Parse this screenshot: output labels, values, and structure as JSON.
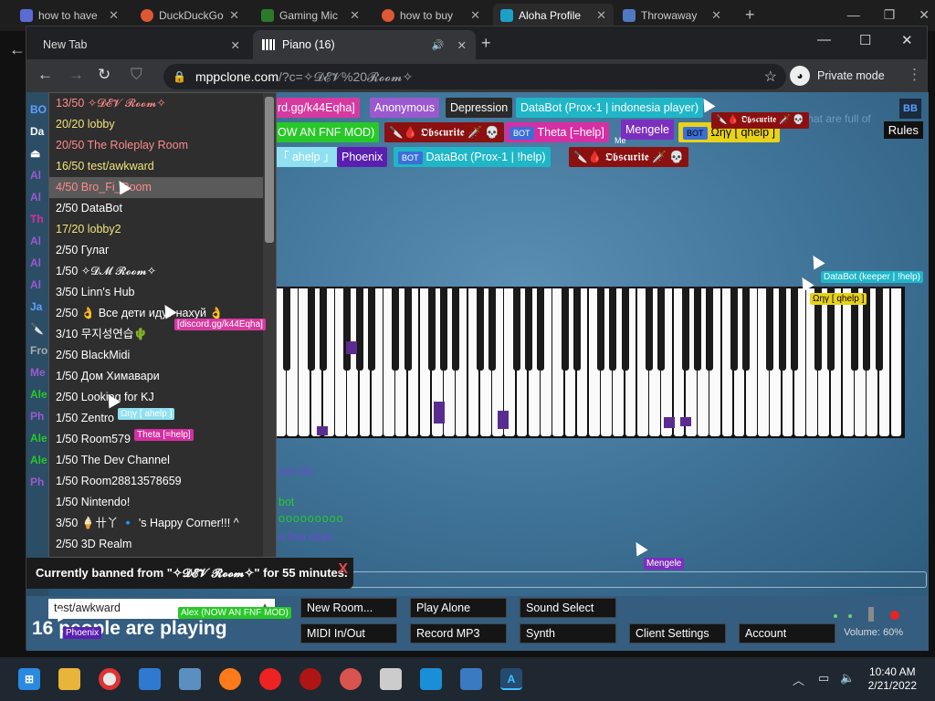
{
  "background_tabs": [
    {
      "title": "how to have",
      "color": "#5b6bd6"
    },
    {
      "title": "DuckDuckGo",
      "color": "#de5833"
    },
    {
      "title": "Gaming Mic",
      "color": "#2a7a2a"
    },
    {
      "title": "how to buy",
      "color": "#de5833"
    },
    {
      "title": "Aloha Profile",
      "color": "#1ba0c8"
    },
    {
      "title": "Throwaway",
      "color": "#4f79c0"
    }
  ],
  "window": {
    "tabs": [
      {
        "title": "New Tab"
      },
      {
        "title": "Piano (16)",
        "icon": "piano-icon",
        "audio": "speaker-icon"
      }
    ],
    "url_domain": "mppclone.com",
    "url_rest": "/?c=✧𝓓𝓔𝓥%20𝓡𝓸𝓸𝓶✧",
    "private_label": "Private mode"
  },
  "names": [
    {
      "label": "rd.gg/k44Eqha]",
      "bg": "#d63aa0",
      "bot": false
    },
    {
      "label": "Anonymous",
      "bg": "#9b59d0",
      "bot": false
    },
    {
      "label": "Depression",
      "bg": "#2a2a2a",
      "bot": false
    },
    {
      "label": "DataBot (Prox-1 | indonesia player)",
      "bg": "#1fb6c8",
      "bot": false
    },
    {
      "label": "OW AN FNF MOD)",
      "bg": "#28c828",
      "bot": false
    },
    {
      "label": "🔪🩸 𝕺𝖇𝖘𝖈𝖚𝖗𝖎𝖙𝖊 🗡️ 💀",
      "bg": "#8b1010",
      "bot": false
    },
    {
      "label": "Theta [=help]",
      "bg": "#d62fa3",
      "bot": true
    },
    {
      "label": "Mengele",
      "bg": "#7b2fbf",
      "bot": false
    },
    {
      "label": "Ωηγ [ qhelp ]",
      "bg": "#e8d21a",
      "bot": true
    },
    {
      "label": "「 ahelp 」",
      "bg": "#8fe0f0",
      "bot": false
    },
    {
      "label": "Phoenix",
      "bg": "#5a1fb0",
      "bot": false
    },
    {
      "label": "DataBot (Prox-1 | !help)",
      "bg": "#1fb6c8",
      "bot": true
    },
    {
      "label": "🔪🩸 𝕺𝖇𝖘𝖈𝖚𝖗𝖎𝖙𝖊 🗡️ 💀",
      "bg": "#8b1010",
      "bot": false
    }
  ],
  "bot_badge": "BOT",
  "me_label": "Me",
  "rules_label": "Rules",
  "bb_label": "BB",
  "bg_chat_top": "that are full of",
  "rooms": [
    {
      "text": "13/50 ✧𝓓𝓔𝓥 𝓡𝓸𝓸𝓶✧",
      "color": "#ff8a8a"
    },
    {
      "text": "20/20 lobby",
      "color": "#f2e27a"
    },
    {
      "text": "20/50 The Roleplay Room",
      "color": "#ff8a8a"
    },
    {
      "text": "16/50 test/awkward",
      "color": "#f2e27a"
    },
    {
      "text": "4/50 Bro_Fi_Room",
      "color": "#ff8a8a"
    },
    {
      "text": "2/50 DataBot",
      "color": "#ffffff"
    },
    {
      "text": "17/20 lobby2",
      "color": "#f2e27a"
    },
    {
      "text": "2/50 Гулаг",
      "color": "#ffffff"
    },
    {
      "text": "1/50 ✧𝓓𝓜 𝓡𝓸𝓸𝓶✧",
      "color": "#ffffff"
    },
    {
      "text": "3/50 Linn's Hub",
      "color": "#ffffff"
    },
    {
      "text": "2/50 👌 Все дети идут нахуй 👌",
      "color": "#ffffff"
    },
    {
      "text": "3/10 무지성연습🌵",
      "color": "#ffffff"
    },
    {
      "text": "2/50 BlackMidi",
      "color": "#ffffff"
    },
    {
      "text": "1/50 Дом Химавари",
      "color": "#ffffff"
    },
    {
      "text": "2/50 Looking for KJ",
      "color": "#ffffff"
    },
    {
      "text": "1/50 Zentro",
      "color": "#ffffff"
    },
    {
      "text": "1/50 Room579",
      "color": "#ffffff"
    },
    {
      "text": "1/50 The Dev Channel",
      "color": "#ffffff"
    },
    {
      "text": "1/50 Room28813578659",
      "color": "#ffffff"
    },
    {
      "text": "1/50 Nintendo!",
      "color": "#ffffff"
    },
    {
      "text": "3/50 🍦卄丫 🔹 's Happy Corner!!! ^",
      "color": "#ffffff"
    },
    {
      "text": "2/50 3D Realm",
      "color": "#ffffff"
    }
  ],
  "left_strip": [
    {
      "t": "BO",
      "c": "#5ea0ff"
    },
    {
      "t": "Da",
      "c": "#ffffff"
    },
    {
      "t": "⏏",
      "c": "#ffffff"
    },
    {
      "t": "Al",
      "c": "#9b59d0"
    },
    {
      "t": "Al",
      "c": "#9b59d0"
    },
    {
      "t": "Th",
      "c": "#d62fa3"
    },
    {
      "t": "Al",
      "c": "#9b59d0"
    },
    {
      "t": "Al",
      "c": "#9b59d0"
    },
    {
      "t": "Al",
      "c": "#9b59d0"
    },
    {
      "t": "Ja",
      "c": "#5ea0ff"
    },
    {
      "t": "🔪",
      "c": "#ffffff"
    },
    {
      "t": "Fro",
      "c": "#aaaaaa"
    },
    {
      "t": "Me",
      "c": "#9b59d0"
    },
    {
      "t": "Ale",
      "c": "#28c828"
    },
    {
      "t": "Ph",
      "c": "#9b59d0"
    },
    {
      "t": "Ale",
      "c": "#28c828"
    },
    {
      "t": "Ale",
      "c": "#28c828"
    },
    {
      "t": "Ph",
      "c": "#9b59d0"
    }
  ],
  "chat": [
    {
      "text": "sux dix",
      "color": "#6a4bd0"
    },
    {
      "text": "bot",
      "color": "#28c828"
    },
    {
      "text": "ooooooooo",
      "color": "#28c828"
    },
    {
      "text": "a few days",
      "color": "#6a4bd0"
    }
  ],
  "ban_notice": "Currently banned from \"✧𝓓𝓔𝓥 𝓡𝓸𝓸𝓶✧\" for 55 minutes.",
  "ban_close": "X",
  "cursor_labels": [
    {
      "label": "[discord.gg/k44Eqha]",
      "bg": "#d63aa0",
      "color": "#ffffff"
    },
    {
      "label": "Ωηγ [ ahelp ]",
      "bg": "#8fe0f0",
      "color": "#ffffff"
    },
    {
      "label": "Theta [=help]",
      "bg": "#d62fa3",
      "color": "#ffffff"
    },
    {
      "label": "DataBot (keeper | !help)",
      "bg": "#1fb6c8",
      "color": "#ffffff"
    },
    {
      "label": "Ωηγ [ qhelp ]",
      "bg": "#e8d21a",
      "color": "#000000"
    },
    {
      "label": "Mengele",
      "bg": "#7b2fbf",
      "color": "#ffffff"
    },
    {
      "label": "Alex (NOW AN FNF MOD)",
      "bg": "#28c828",
      "color": "#ffffff"
    },
    {
      "label": "Phoenix",
      "bg": "#5a1fb0",
      "color": "#ffffff"
    }
  ],
  "bottom": {
    "room_input_value": "test/awkward",
    "people_text": "16 people are playing",
    "buttons": [
      "New Room...",
      "Play Alone",
      "Sound Select",
      "MIDI In/Out",
      "Record MP3",
      "Synth",
      "Client Settings",
      "Account"
    ],
    "volume": "Volume: 60%"
  },
  "taskbar": {
    "time": "10:40 AM",
    "date": "2/21/2022"
  }
}
